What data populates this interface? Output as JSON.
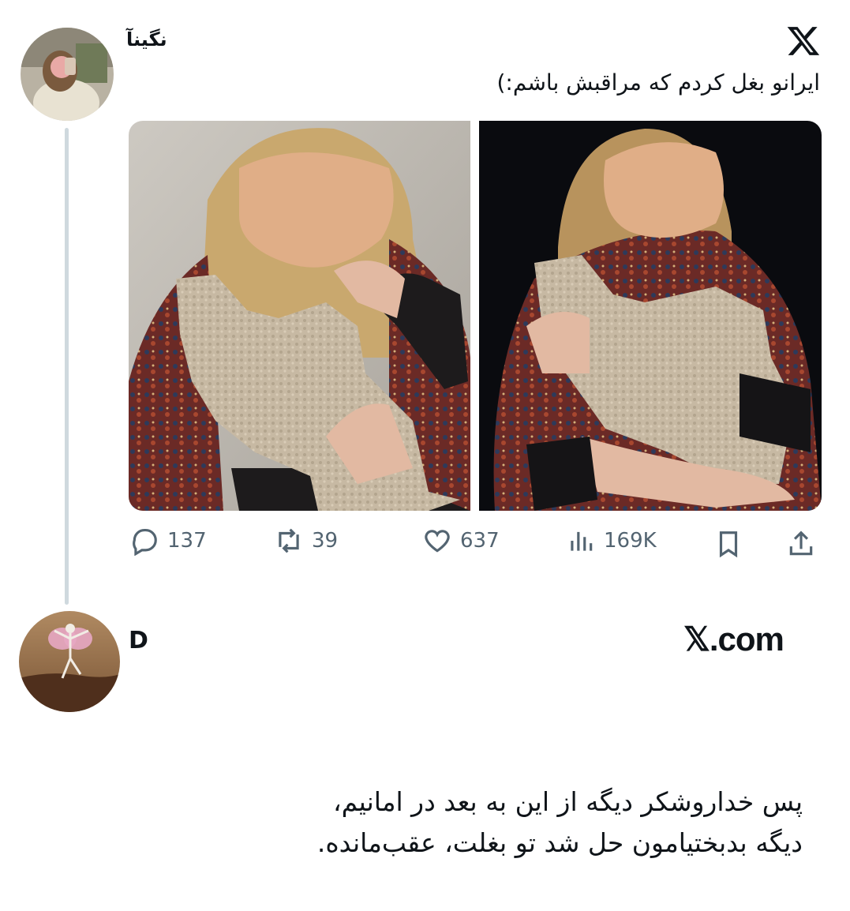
{
  "tweet": {
    "author": "نگینآ",
    "text": "ایرانو بغل کردم که مراقبش باشم:)",
    "stats": {
      "replies": "137",
      "retweets": "39",
      "likes": "637",
      "views": "169K"
    }
  },
  "reply": {
    "author": "D",
    "platform_label": "𝕏.com",
    "lines": [
      "پس خداروشکر دیگه از این به بعد در امانیم،",
      "دیگه بدبختیامون حل شد تو بغلت، عقب‌مانده."
    ]
  },
  "icons": {
    "logo": "x-logo-icon",
    "reply": "reply-icon",
    "retweet": "retweet-icon",
    "like": "heart-icon",
    "views": "views-icon",
    "bookmark": "bookmark-icon",
    "share": "share-icon"
  },
  "colors": {
    "text": "#0f1419",
    "secondary": "#536471",
    "thread_line": "#cfd9de",
    "background": "#ffffff"
  }
}
